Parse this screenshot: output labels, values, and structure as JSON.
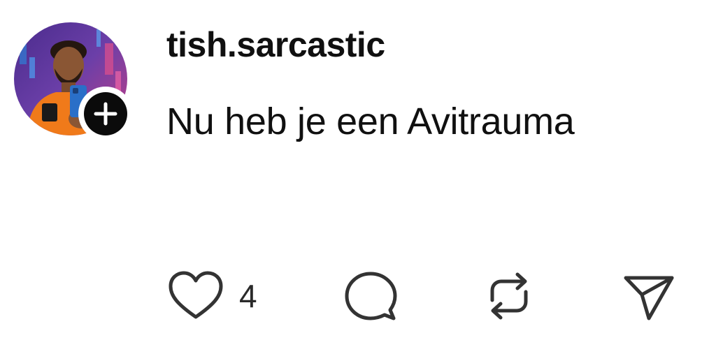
{
  "post": {
    "username": "tish.sarcastic",
    "text": "Nu heb je een Avitrauma",
    "avatar_icon": "profile-photo",
    "follow_icon": "plus-icon"
  },
  "actions": {
    "like": {
      "icon": "heart-icon",
      "count": "4"
    },
    "comment": {
      "icon": "comment-icon"
    },
    "repost": {
      "icon": "repost-icon"
    },
    "share": {
      "icon": "send-icon"
    }
  },
  "colors": {
    "text": "#101010",
    "icon": "#333333",
    "follow_badge": "#0b0b0b",
    "background": "#ffffff"
  }
}
